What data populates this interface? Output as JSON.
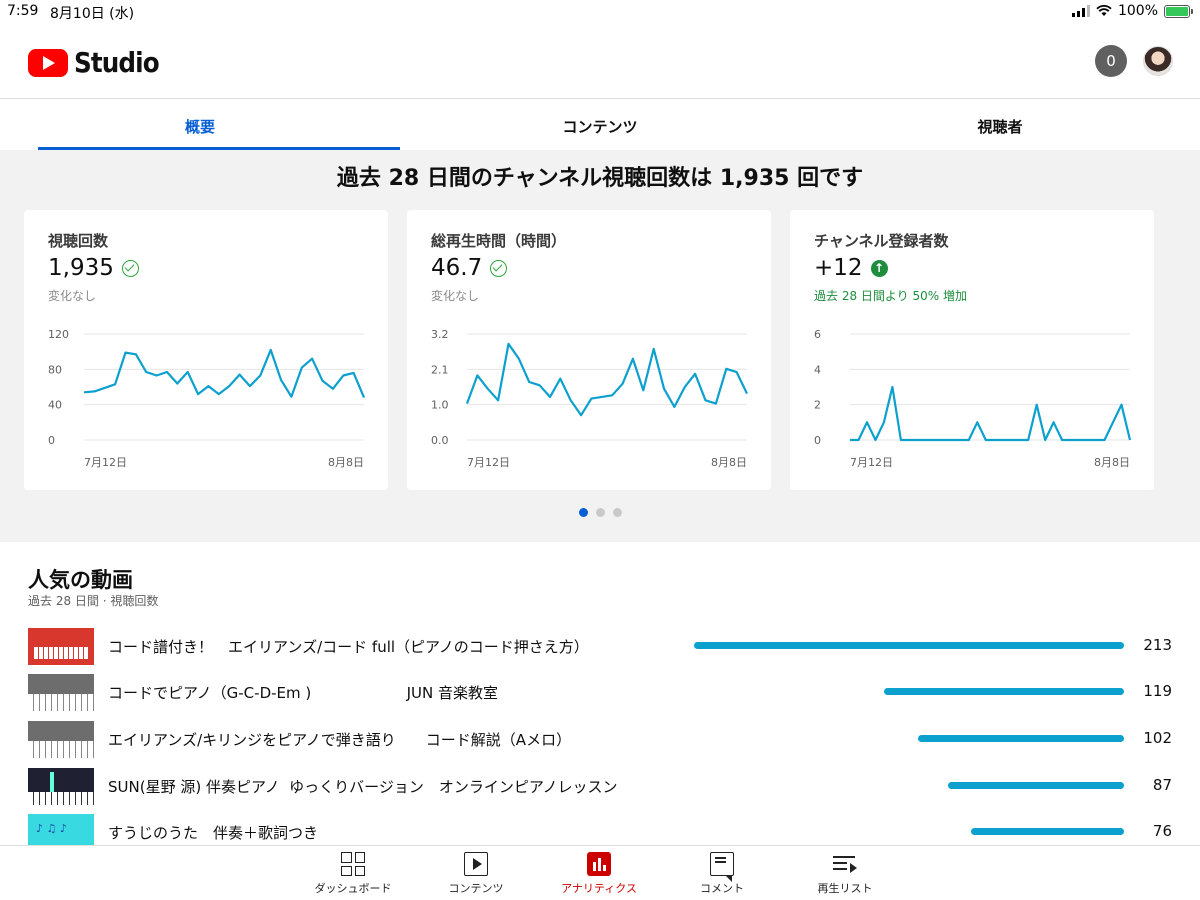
{
  "status_bar": {
    "time": "7:59",
    "date": "8月10日 (水)",
    "battery": "100%",
    "icons": [
      "signal-icon",
      "wifi-icon",
      "battery-charging-icon"
    ]
  },
  "header": {
    "logo_text": "Studio",
    "notification_count": "0",
    "icons": [
      "youtube-play-icon",
      "avatar"
    ]
  },
  "tabs": [
    {
      "label": "概要",
      "active": true
    },
    {
      "label": "コンテンツ",
      "active": false
    },
    {
      "label": "視聴者",
      "active": false
    }
  ],
  "overview": {
    "headline": "過去 28 日間のチャンネル視聴回数は 1,935 回です",
    "pager": {
      "count": 3,
      "active": 0
    },
    "cards": [
      {
        "label": "視聴回数",
        "value": "1,935",
        "status_icon": "check-circle-icon",
        "note": "変化なし"
      },
      {
        "label": "総再生時間（時間）",
        "value": "46.7",
        "status_icon": "check-circle-icon",
        "note": "変化なし"
      },
      {
        "label": "チャンネル登録者数",
        "value": "+12",
        "status_icon": "arrow-up-circle-icon",
        "note": "過去 28 日間より 50% 増加"
      }
    ]
  },
  "chart_data": [
    {
      "type": "line",
      "x_start_label": "7月12日",
      "x_end_label": "8月8日",
      "y_ticks": [
        "0",
        "40",
        "80",
        "120"
      ],
      "ylim": [
        0,
        120
      ],
      "grid": true,
      "color": "#0ba0ce",
      "series": [
        {
          "values": [
            54,
            55,
            59,
            63,
            99,
            97,
            77,
            73,
            77,
            64,
            77,
            52,
            61,
            52,
            61,
            74,
            61,
            73,
            102,
            68,
            49,
            82,
            92,
            67,
            58,
            73,
            76,
            48
          ]
        }
      ]
    },
    {
      "type": "line",
      "x_start_label": "7月12日",
      "x_end_label": "8月8日",
      "y_ticks": [
        "0.0",
        "1.0",
        "2.1",
        "3.2"
      ],
      "ylim": [
        0,
        3.2
      ],
      "grid": true,
      "color": "#0ba0ce",
      "series": [
        {
          "values": [
            1.1,
            1.95,
            1.55,
            1.2,
            2.9,
            2.45,
            1.75,
            1.65,
            1.3,
            1.85,
            1.2,
            0.75,
            1.25,
            1.3,
            1.35,
            1.7,
            2.45,
            1.5,
            2.75,
            1.55,
            1.0,
            1.6,
            2.0,
            1.2,
            1.1,
            2.15,
            2.05,
            1.4
          ]
        }
      ]
    },
    {
      "type": "line",
      "x_start_label": "7月12日",
      "x_end_label": "8月8日",
      "y_ticks": [
        "0",
        "2",
        "4",
        "6"
      ],
      "ylim": [
        0,
        6
      ],
      "grid": true,
      "color": "#0ba0ce",
      "series": [
        {
          "values": [
            0,
            0,
            1,
            0,
            1,
            3,
            0,
            0,
            0,
            0,
            0,
            0,
            0,
            0,
            0,
            1,
            0,
            0,
            0,
            0,
            0,
            0,
            2,
            0,
            1,
            0,
            0,
            0,
            0,
            0,
            0,
            1,
            2,
            0
          ]
        }
      ]
    }
  ],
  "popular": {
    "title": "人気の動画",
    "subtitle": "過去 28 日間 · 視聴回数",
    "max_views": 213,
    "videos": [
      {
        "title": "コード譜付き！　エイリアンズ/コード full（ピアノのコード押さえ方）",
        "views": 213,
        "views_label": "213",
        "thumb": "red"
      },
      {
        "title": "コードでピアノ（G-C-D-Em )                    JUN 音楽教室",
        "views": 119,
        "views_label": "119",
        "thumb": "piano"
      },
      {
        "title": "エイリアンズ/キリンジをピアノで弾き語り　　コード解説（Aメロ）",
        "views": 102,
        "views_label": "102",
        "thumb": "piano"
      },
      {
        "title": "SUN(星野 源) 伴奏ピアノ  ゆっくりバージョン　オンラインピアノレッスン",
        "views": 87,
        "views_label": "87",
        "thumb": "dark"
      },
      {
        "title": "すうじのうた　伴奏＋歌詞つき",
        "views": 76,
        "views_label": "76",
        "thumb": "cyan"
      }
    ]
  },
  "bottom_nav": [
    {
      "label": "ダッシュボード",
      "icon": "dashboard-icon",
      "active": false
    },
    {
      "label": "コンテンツ",
      "icon": "content-icon",
      "active": false
    },
    {
      "label": "アナリティクス",
      "icon": "analytics-icon",
      "active": true
    },
    {
      "label": "コメント",
      "icon": "comment-icon",
      "active": false
    },
    {
      "label": "再生リスト",
      "icon": "playlist-icon",
      "active": false
    }
  ]
}
